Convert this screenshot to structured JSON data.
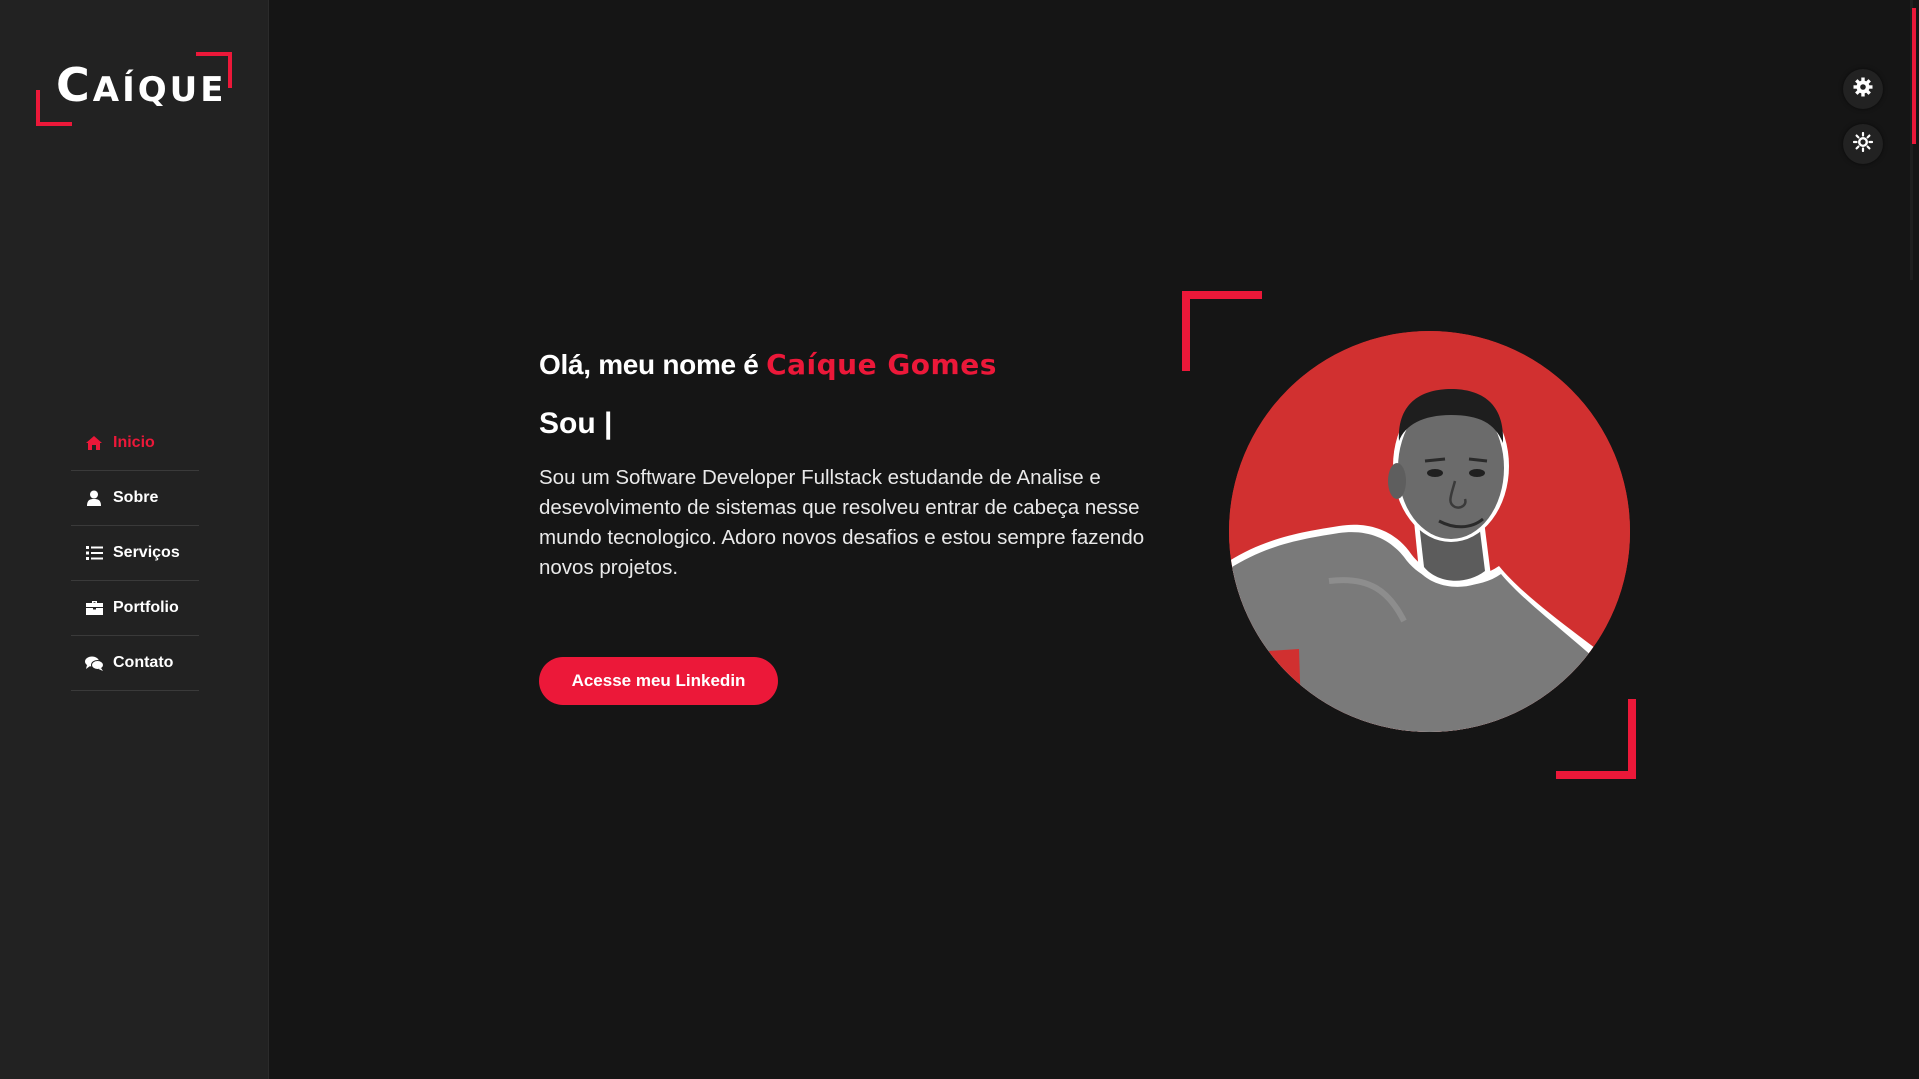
{
  "colors": {
    "accent": "#ec1839",
    "background": "#151515",
    "sidebar": "#222222",
    "photo_bg": "#d13030"
  },
  "logo": {
    "first_letter": "C",
    "rest": "AÍQUE"
  },
  "nav": {
    "items": [
      {
        "label": "Inicio",
        "icon": "home-icon",
        "active": true
      },
      {
        "label": "Sobre",
        "icon": "user-icon",
        "active": false
      },
      {
        "label": "Serviços",
        "icon": "list-icon",
        "active": false
      },
      {
        "label": "Portfolio",
        "icon": "briefcase-icon",
        "active": false
      },
      {
        "label": "Contato",
        "icon": "comments-icon",
        "active": false
      }
    ]
  },
  "hero": {
    "greeting": "Olá, meu nome é ",
    "name": "Caíque Gomes",
    "typing_prefix": "Sou |",
    "description": "Sou um Software Developer Fullstack estudande de Analise e desevolvimento de sistemas que resolveu entrar de cabeça nesse mundo tecnologico. Adoro novos desafios e estou sempre fazendo novos projetos.",
    "button_label": "Acesse meu Linkedin"
  },
  "style_switcher": {
    "settings_icon": "gear-icon",
    "theme_icon": "sun-icon"
  }
}
